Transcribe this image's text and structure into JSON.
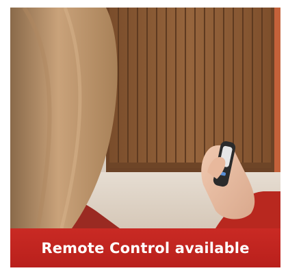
{
  "caption": {
    "text": "Remote Control available"
  },
  "colors": {
    "caption_background": "#c0231e",
    "caption_text": "#ffffff",
    "garage_door": "#8a5a34",
    "brick": "#c4613a"
  },
  "photo": {
    "icon": "woman-with-remote-photo"
  }
}
